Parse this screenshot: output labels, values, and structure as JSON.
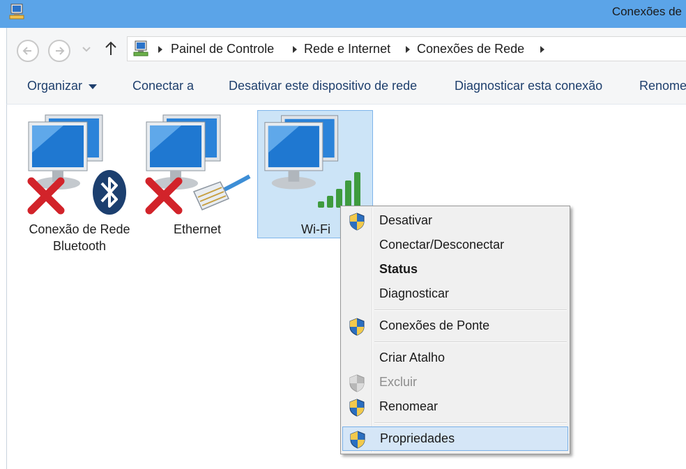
{
  "window": {
    "title": "Conexões de"
  },
  "address_bar": {
    "breadcrumbs": [
      "Painel de Controle",
      "Rede e Internet",
      "Conexões de Rede"
    ]
  },
  "toolbar": {
    "organize": "Organizar",
    "connect": "Conectar a",
    "disable": "Desativar este dispositivo de rede",
    "diagnose": "Diagnosticar esta conexão",
    "rename": "Renome"
  },
  "connections": [
    {
      "label_line1": "Conexão de Rede",
      "label_line2": "Bluetooth",
      "status_icon": "red-x-icon",
      "badge_icon": "bluetooth-icon"
    },
    {
      "label_line1": "Ethernet",
      "label_line2": "",
      "status_icon": "red-x-icon",
      "badge_icon": "ethernet-cable-icon"
    },
    {
      "label_line1": "Wi-Fi",
      "label_line2": "",
      "status_icon": "",
      "badge_icon": "wifi-signal-icon",
      "selected": true
    }
  ],
  "context_menu": {
    "items": [
      {
        "label": "Desativar",
        "icon": "uac-shield-icon"
      },
      {
        "label": "Conectar/Desconectar",
        "icon": ""
      },
      {
        "label": "Status",
        "icon": "",
        "bold": true
      },
      {
        "label": "Diagnosticar",
        "icon": ""
      },
      {
        "label": "Conexões de Ponte",
        "icon": "uac-shield-icon"
      },
      {
        "label": "Criar Atalho",
        "icon": ""
      },
      {
        "label": "Excluir",
        "icon": "uac-shield-icon",
        "disabled": true
      },
      {
        "label": "Renomear",
        "icon": "uac-shield-icon"
      },
      {
        "label": "Propriedades",
        "icon": "uac-shield-icon",
        "highlighted": true
      }
    ]
  },
  "colors": {
    "titlebar": "#5ba4e8",
    "selection_fill": "#cce4f7",
    "selection_border": "#7eb4ea",
    "menu_hover": "#d5e6f7"
  }
}
